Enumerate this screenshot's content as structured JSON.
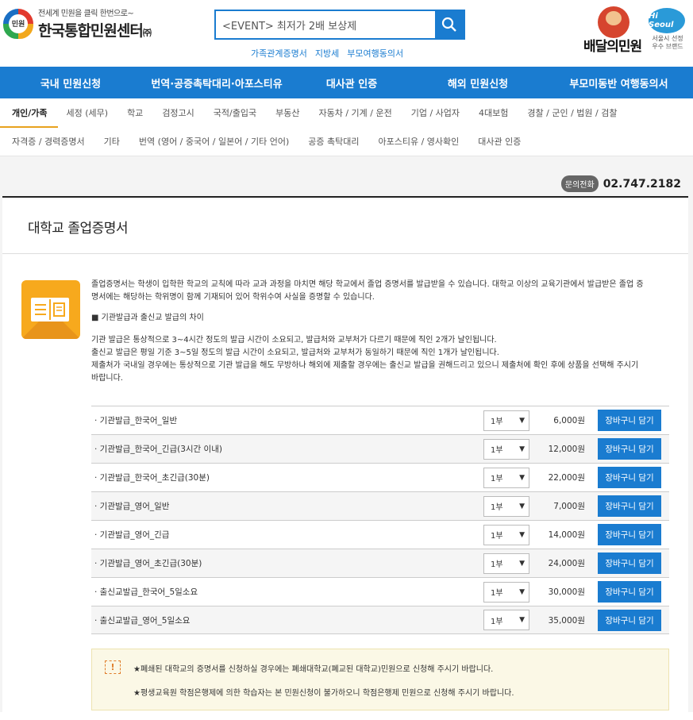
{
  "header": {
    "logo_badge": "민원",
    "logo_sub": "전세계 민원을 클릭 한번으로~",
    "logo_main": "한국통합민원센터",
    "logo_suffix": "㈜",
    "search_value": "<EVENT> 최저가 2배 보상제",
    "quick_links": [
      "가족관계증명서",
      "지방세",
      "부모여행동의서"
    ],
    "brand_text": "배달의민원",
    "hiseoul": "Hi Seoul",
    "hiseoul_sub": "서울시 선정 우수 브랜드"
  },
  "main_nav": [
    "국내 민원신청",
    "번역·공증촉탁대리·아포스티유",
    "대사관 인증",
    "해외 민원신청",
    "부모미동반 여행동의서"
  ],
  "sub_nav_row1": [
    "개인/가족",
    "세정 (세무)",
    "학교",
    "검정고시",
    "국적/출입국",
    "부동산",
    "자동차 / 기계 / 운전",
    "기업 / 사업자",
    "4대보험",
    "경찰 / 군인 / 법원 / 검찰"
  ],
  "sub_nav_row2": [
    "자격증 / 경력증명서",
    "기타",
    "번역 (영어 / 중국어 / 일본어 / 기타 언어)",
    "공증 촉탁대리",
    "아포스티유 / 영사확인",
    "대사관 인증"
  ],
  "contact": {
    "badge": "문의전화",
    "number": "02.747.2182"
  },
  "page": {
    "title": "대학교 졸업증명서",
    "desc1": "졸업증명서는 학생이 입학한 학교의 교칙에 따라 교과 과정을 마치면 해당 학교에서 졸업 증명서를 발급받을 수 있습니다. 대학교 이상의 교육기관에서 발급받은 졸업 증명서에는 해당하는 학위명이 함께 기재되어 있어 학위수여 사실을 증명할 수 있습니다.",
    "subhead": "■ 기관발급과 출신교 발급의 차이",
    "desc2_lines": [
      "기관 발급은 통상적으로 3~4시간 정도의 발급 시간이 소요되고, 발급처와 교부처가 다르기 때문에 직인 2개가 날인됩니다.",
      "출신교 발급은 평일 기준 3~5일 정도의 발급 시간이 소요되고, 발급처와 교부처가 동일하기 때문에 직인 1개가 날인됩니다.",
      "제출처가 국내일 경우에는 통상적으로 기관 발급을 해도 무방하나 해외에 제출할 경우에는 출신교 발급을 권해드리고 있으니 제출처에 확인 후에 상품을 선택해 주시기 바랍니다."
    ]
  },
  "products": [
    {
      "name": "· 기관발급_한국어_일반",
      "qty": "1부",
      "price": "6,000원",
      "btn": "장바구니 담기"
    },
    {
      "name": "· 기관발급_한국어_긴급(3시간 이내)",
      "qty": "1부",
      "price": "12,000원",
      "btn": "장바구니 담기"
    },
    {
      "name": "· 기관발급_한국어_초긴급(30분)",
      "qty": "1부",
      "price": "22,000원",
      "btn": "장바구니 담기"
    },
    {
      "name": "· 기관발급_영어_일반",
      "qty": "1부",
      "price": "7,000원",
      "btn": "장바구니 담기"
    },
    {
      "name": "· 기관발급_영어_긴급",
      "qty": "1부",
      "price": "14,000원",
      "btn": "장바구니 담기"
    },
    {
      "name": "· 기관발급_영어_초긴급(30분)",
      "qty": "1부",
      "price": "24,000원",
      "btn": "장바구니 담기"
    },
    {
      "name": "· 출신교발급_한국어_5일소요",
      "qty": "1부",
      "price": "30,000원",
      "btn": "장바구니 담기"
    },
    {
      "name": "· 출신교발급_영어_5일소요",
      "qty": "1부",
      "price": "35,000원",
      "btn": "장바구니 담기"
    }
  ],
  "notice": {
    "icon": "!",
    "line1": "★폐쇄된 대학교의 증명서를 신청하실 경우에는 폐쇄대학교(폐교된 대학교)민원으로 신청해 주시기 바랍니다.",
    "line2": "★평생교육원 학점은행제에 의한 학습자는 본 민원신청이 불가하오니 학점은행제 민원으로 신청해 주시기 바랍니다."
  },
  "colors": {
    "primary": "#1a7cd0",
    "accent": "#f7a91d"
  }
}
